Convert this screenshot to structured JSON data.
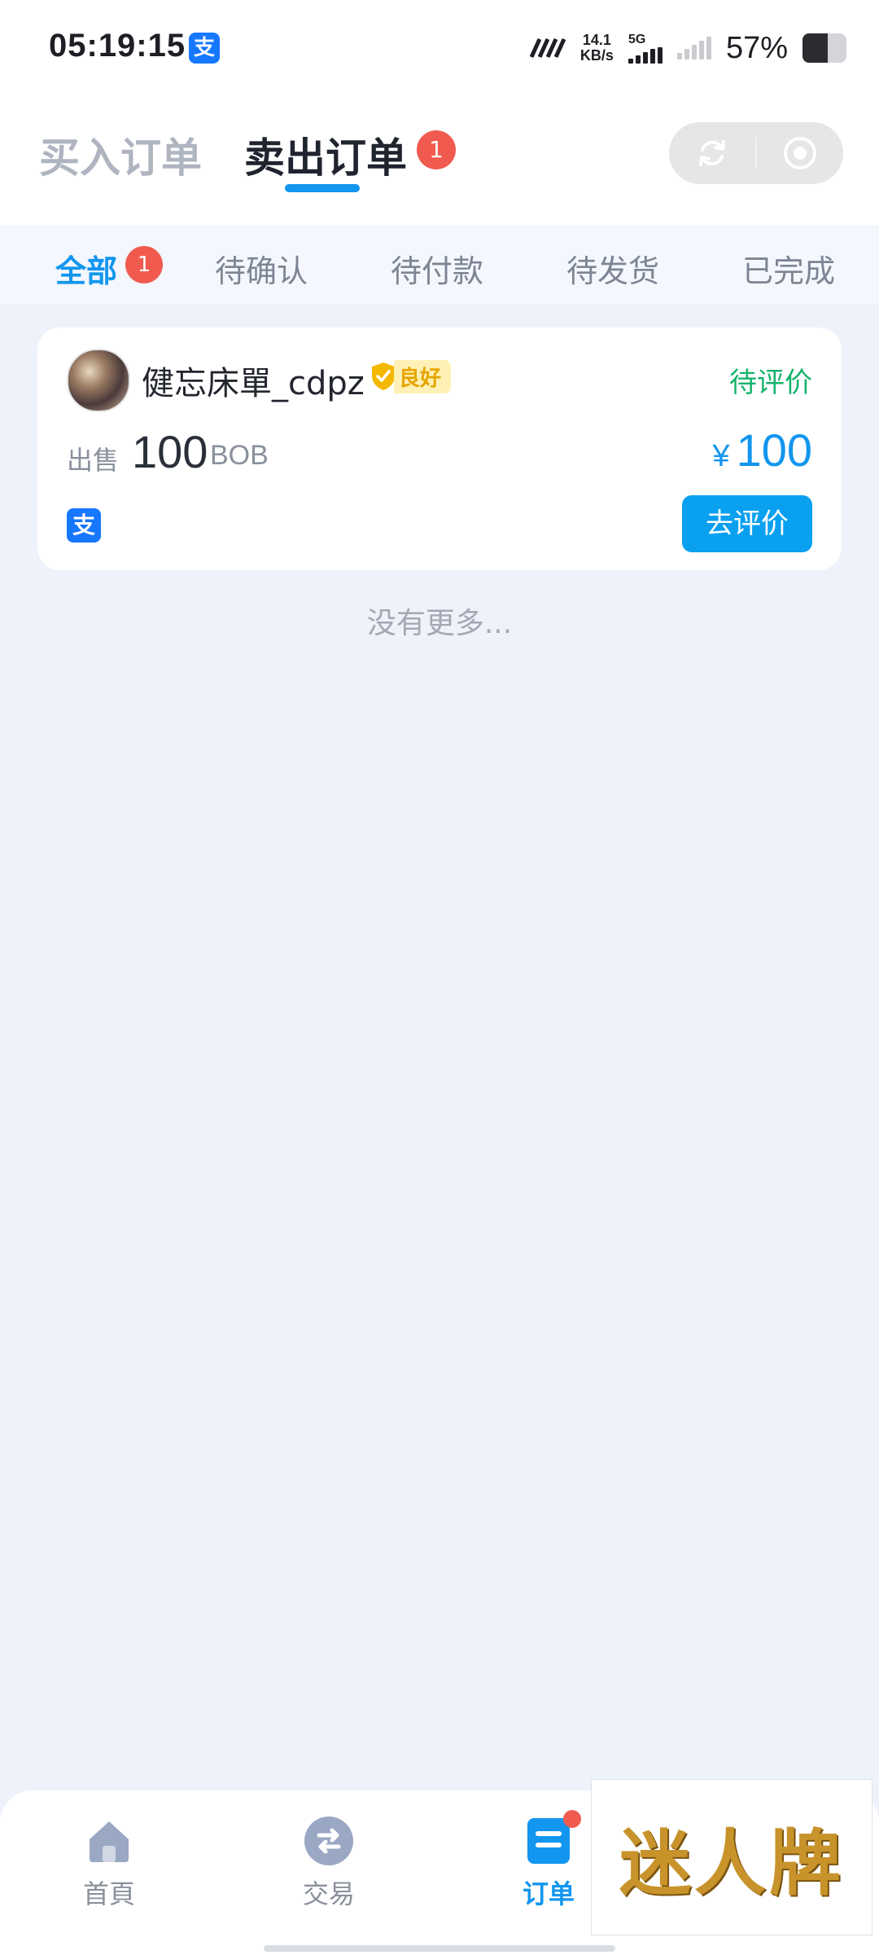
{
  "status_bar": {
    "time": "05:19:15",
    "app_icon": "支",
    "net_speed_value": "14.1",
    "net_speed_unit": "KB/s",
    "network": "5G",
    "battery_text": "57%",
    "battery_level": 0.57
  },
  "header": {
    "tabs": [
      {
        "label": "买入订单",
        "active": false
      },
      {
        "label": "卖出订单",
        "active": true,
        "badge": "1"
      }
    ]
  },
  "filters": {
    "tabs": [
      {
        "label": "全部",
        "active": true,
        "badge": "1"
      },
      {
        "label": "待确认"
      },
      {
        "label": "待付款"
      },
      {
        "label": "待发货"
      },
      {
        "label": "已完成"
      }
    ]
  },
  "orders": [
    {
      "username": "健忘床單_cdpz",
      "rating": "良好",
      "status": "待评价",
      "type_label": "出售",
      "amount": "100",
      "unit": "BOB",
      "currency_symbol": "¥",
      "price": "100",
      "payment_icon": "支",
      "action_label": "去评价"
    }
  ],
  "list_footer": "没有更多...",
  "bottom_nav": {
    "items": [
      {
        "label": "首頁",
        "icon": "home-icon"
      },
      {
        "label": "交易",
        "icon": "exchange-icon"
      },
      {
        "label": "订单",
        "icon": "orders-icon",
        "active": true
      }
    ]
  },
  "watermark": "迷人牌",
  "colors": {
    "accent": "#1296ef",
    "badge": "#f05a4f",
    "status_green": "#14b36b",
    "background": "#eef2fa"
  }
}
